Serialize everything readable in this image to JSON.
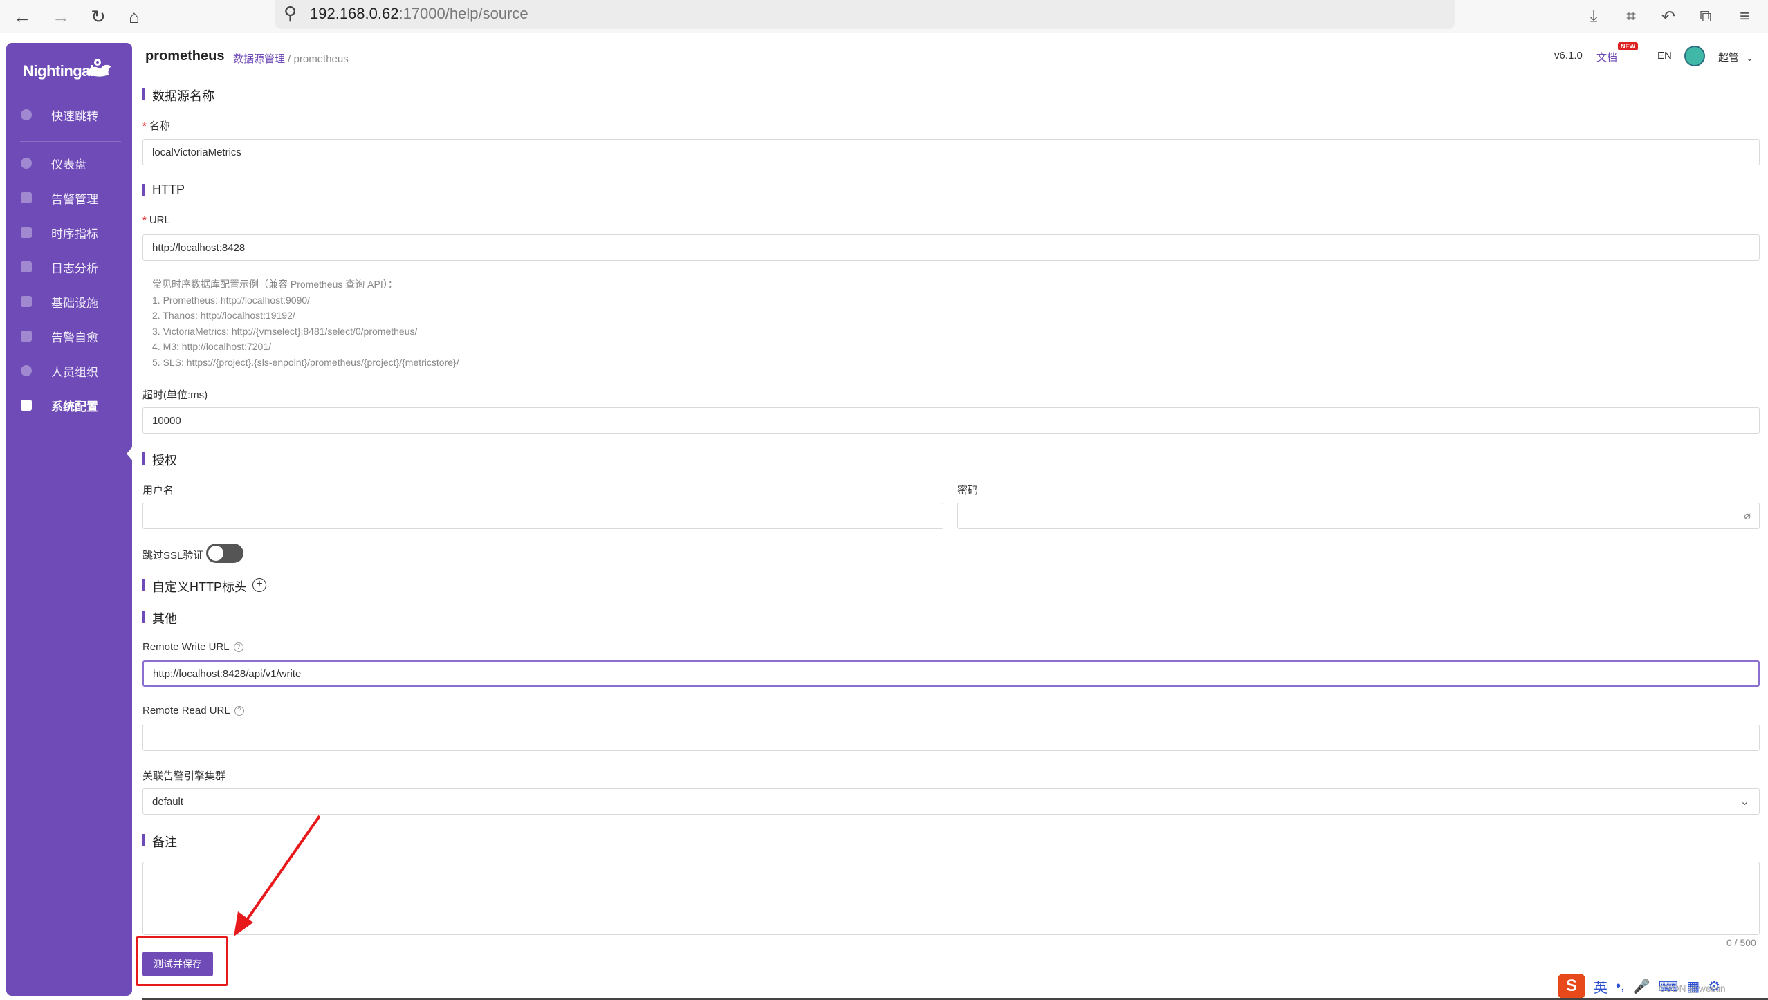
{
  "browser": {
    "url_host": "192.168.0.62",
    "url_rest": ":17000/help/source"
  },
  "sidebar": {
    "logo": "Nightingale",
    "items": [
      {
        "label": "快速跳转",
        "icon": "search-icon"
      },
      {
        "label": "仪表盘",
        "icon": "dashboard-icon"
      },
      {
        "label": "告警管理",
        "icon": "alarm-icon"
      },
      {
        "label": "时序指标",
        "icon": "chart-icon"
      },
      {
        "label": "日志分析",
        "icon": "log-icon"
      },
      {
        "label": "基础设施",
        "icon": "server-icon"
      },
      {
        "label": "告警自愈",
        "icon": "terminal-icon"
      },
      {
        "label": "人员组织",
        "icon": "user-icon"
      },
      {
        "label": "系统配置",
        "icon": "grid-icon",
        "active": true
      }
    ]
  },
  "header": {
    "title": "prometheus",
    "breadcrumb_link": "数据源管理",
    "breadcrumb_sep": " / ",
    "breadcrumb_current": "prometheus",
    "version": "v6.1.0",
    "docs": "文档",
    "new_badge": "NEW",
    "lang": "EN",
    "user": "超管"
  },
  "form": {
    "section_name": "数据源名称",
    "name_label": "名称",
    "name_value": "localVictoriaMetrics",
    "section_http": "HTTP",
    "url_label": "URL",
    "url_value": "http://localhost:8428",
    "hint_lines": [
      "常见时序数据库配置示例（兼容 Prometheus 查询 API）：",
      "1. Prometheus: http://localhost:9090/",
      "2. Thanos: http://localhost:19192/",
      "3. VictoriaMetrics: http://{vmselect}:8481/select/0/prometheus/",
      "4. M3: http://localhost:7201/",
      "5. SLS: https://{project}.{sls-enpoint}/prometheus/{project}/{metricstore}/"
    ],
    "timeout_label": "超时(单位:ms)",
    "timeout_value": "10000",
    "section_auth": "授权",
    "username_label": "用户名",
    "username_value": "",
    "password_label": "密码",
    "password_value": "",
    "skip_ssl_label": "跳过SSL验证",
    "section_headers": "自定义HTTP标头",
    "section_other": "其他",
    "remote_write_label": "Remote Write URL",
    "remote_write_value": "http://localhost:8428/api/v1/write",
    "remote_read_label": "Remote Read URL",
    "remote_read_value": "",
    "cluster_label": "关联告警引擎集群",
    "cluster_value": "default",
    "section_note": "备注",
    "note_counter": "0 / 500",
    "save_button": "测试并保存"
  },
  "overlay": {
    "watermark": "CSDN @weixin",
    "ime_label": "英"
  },
  "colors": {
    "brand": "#6e4bb7",
    "annotation_red": "#e8191b"
  }
}
